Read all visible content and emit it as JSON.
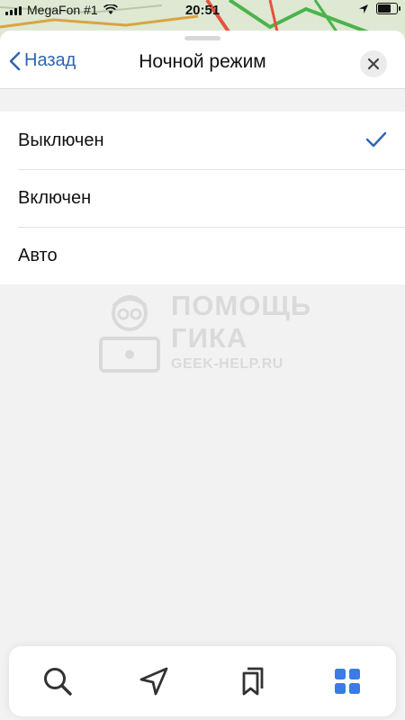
{
  "status_bar": {
    "carrier": "MegaFon #1",
    "time": "20:51",
    "battery_level_percent": 75
  },
  "header": {
    "back_label": "Назад",
    "title": "Ночной режим"
  },
  "options": [
    {
      "label": "Выключен",
      "selected": true
    },
    {
      "label": "Включен",
      "selected": false
    },
    {
      "label": "Авто",
      "selected": false
    }
  ],
  "watermark": {
    "line1": "ПОМОЩЬ",
    "line2": "ГИКА",
    "line3": "GEEK-HELP.RU"
  },
  "tab_bar": {
    "items": [
      {
        "icon": "search-icon"
      },
      {
        "icon": "navigation-arrow-icon"
      },
      {
        "icon": "bookmarks-icon"
      },
      {
        "icon": "grid-menu-icon",
        "active": true
      }
    ]
  },
  "colors": {
    "accent": "#2f64b3",
    "check": "#2f64b3",
    "active_tab": "#3b7be8",
    "icon_gray": "#333333",
    "background": "#f2f2f2"
  }
}
